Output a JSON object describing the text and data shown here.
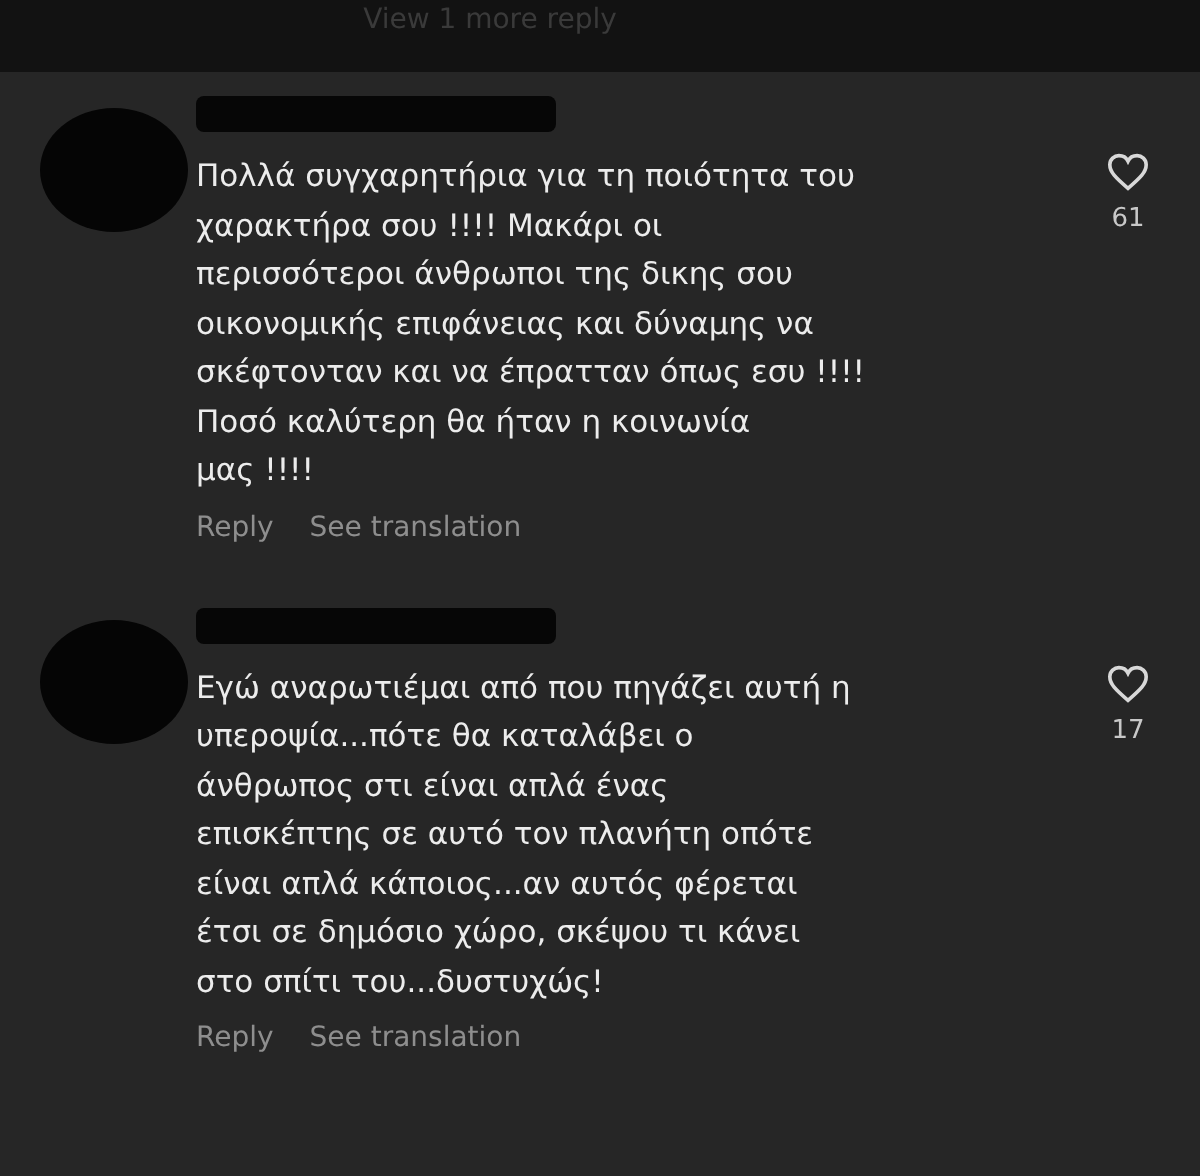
{
  "top_link": "View 1 more reply",
  "comments": [
    {
      "text": "Πολλά συγχαρητήρια για τη ποιότητα του\nχαρακτήρα σου !!!! Μακάρι οι\nπερισσότεροι άνθρωποι της δικης σου\nοικονομικής επιφάνειας και δύναμης να\nσκέφτονταν και να έπρατταν όπως εσυ !!!!\nΠοσό καλύτερη θα ήταν η κοινωνία\nμας !!!!",
      "likes": "61",
      "reply": "Reply",
      "translate": "See translation"
    },
    {
      "text": "Εγώ αναρωτιέμαι από που πηγάζει αυτή η\nυπεροψία...πότε θα καταλάβει ο\nάνθρωπος στι είναι απλά ένας\nεπισκέπτης σε αυτό τον πλανήτη οπότε\nείναι απλά κάποιος...αν αυτός φέρεται\nέτσι σε δημόσιο χώρο, σκέψου τι κάνει\nστο σπίτι του...δυστυχώς!",
      "likes": "17",
      "reply": "Reply",
      "translate": "See translation"
    }
  ]
}
